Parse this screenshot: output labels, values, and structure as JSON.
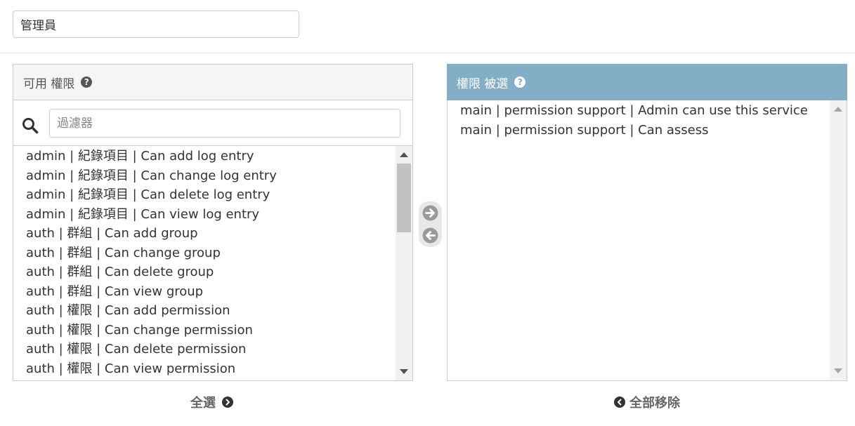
{
  "name_field": {
    "value": "管理員"
  },
  "available": {
    "title": "可用 權限",
    "help_icon": "question-circle-icon",
    "filter_placeholder": "過濾器",
    "items": [
      "admin | 紀錄項目 | Can add log entry",
      "admin | 紀錄項目 | Can change log entry",
      "admin | 紀錄項目 | Can delete log entry",
      "admin | 紀錄項目 | Can view log entry",
      "auth | 群組 | Can add group",
      "auth | 群組 | Can change group",
      "auth | 群組 | Can delete group",
      "auth | 群組 | Can view group",
      "auth | 權限 | Can add permission",
      "auth | 權限 | Can change permission",
      "auth | 權限 | Can delete permission",
      "auth | 權限 | Can view permission"
    ]
  },
  "chosen": {
    "title": "權限 被選",
    "help_icon": "question-circle-icon",
    "items": [
      "main | permission support | Admin can use this service",
      "main | permission support | Can assess"
    ]
  },
  "actions": {
    "select_all": "全選",
    "remove_all": "全部移除"
  },
  "colors": {
    "chosen_header": "#84aec6",
    "available_header": "#f5f5f5",
    "text": "#333333"
  }
}
